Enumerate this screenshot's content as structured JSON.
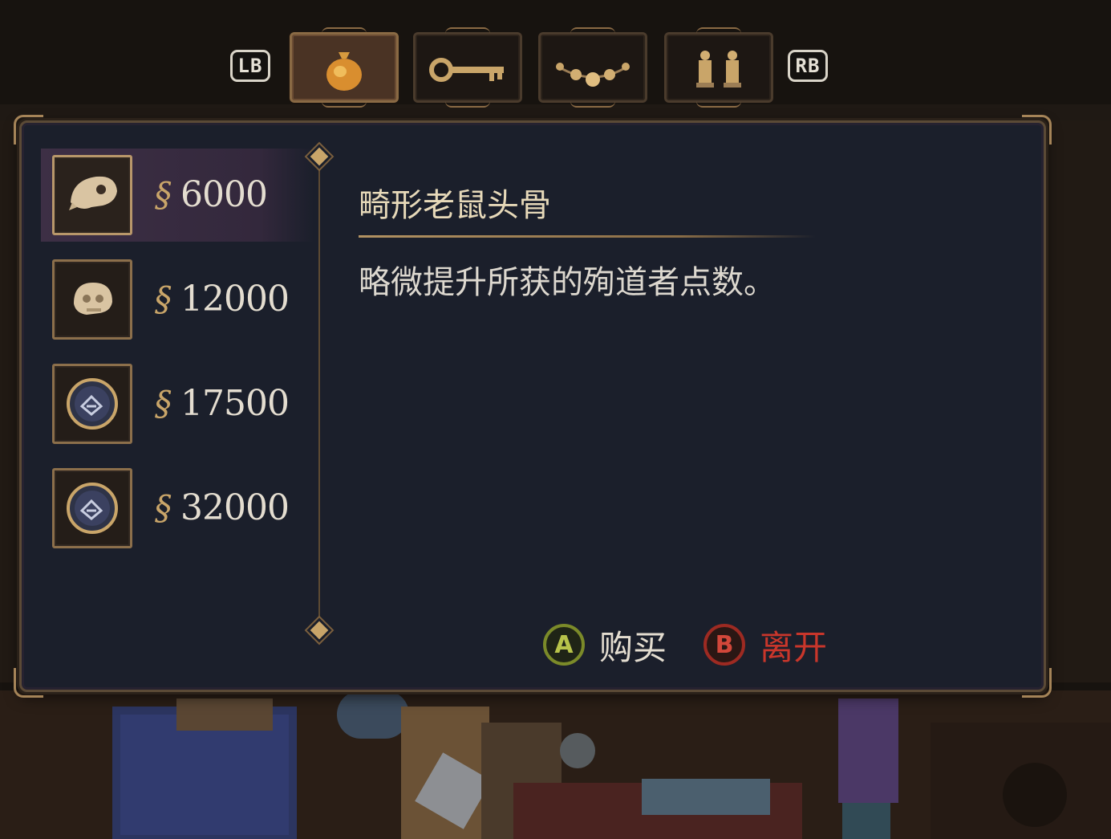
{
  "tabs": {
    "left_shoulder": "LB",
    "right_shoulder": "RB",
    "items": [
      {
        "icon": "money-bag-icon",
        "active": true
      },
      {
        "icon": "key-icon",
        "active": false
      },
      {
        "icon": "bead-necklace-icon",
        "active": false
      },
      {
        "icon": "statuettes-icon",
        "active": false
      }
    ]
  },
  "shop": {
    "currency_icon": "currency-sign-icon",
    "items": [
      {
        "icon": "rat-skull-icon",
        "price": "6000",
        "selected": true
      },
      {
        "icon": "skull-icon",
        "price": "12000",
        "selected": false
      },
      {
        "icon": "crystal-orb-icon",
        "price": "17500",
        "selected": false
      },
      {
        "icon": "crystal-orb-icon",
        "price": "32000",
        "selected": false
      }
    ]
  },
  "detail": {
    "title": "畸形老鼠头骨",
    "description": "略微提升所获的殉道者点数。"
  },
  "prompts": {
    "confirm_button": "A",
    "confirm_label": "购买",
    "cancel_button": "B",
    "cancel_label": "离开"
  },
  "colors": {
    "panel_bg": "#1b1f2b",
    "gold": "#c9a569",
    "confirm": "#b8c34a",
    "cancel": "#c9362b",
    "selected_row": "#3d2f45"
  }
}
